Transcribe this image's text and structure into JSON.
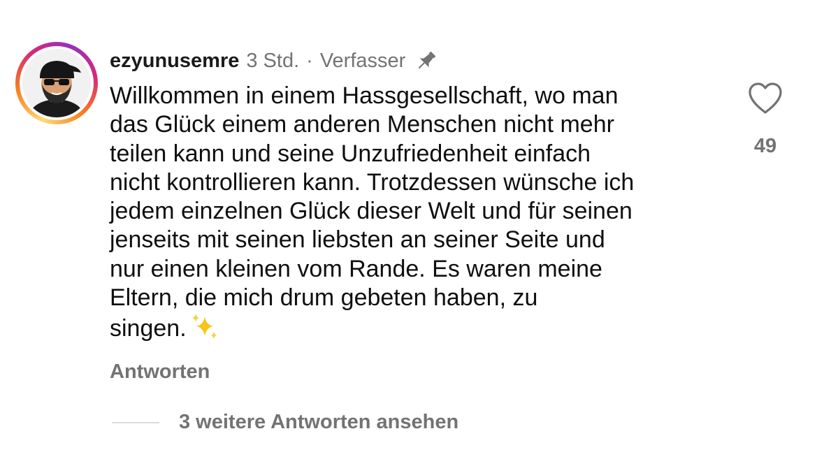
{
  "comment": {
    "username": "ezyunusemre",
    "time": "3 Std.",
    "separator": "·",
    "author_label": "Verfasser",
    "text": "Willkommen in einem Hassgesellschaft, wo man\ndas Glück einem anderen Menschen nicht mehr\nteilen kann und seine Unzufriedenheit einfach\nnicht kontrollieren kann. Trotzdessen wünsche ich\njedem einzelnen Glück dieser Welt und für seinen\njenseits mit seinen liebsten an seiner Seite und\nnur einen kleinen vom Rande. Es waren meine\nEltern, die mich drum gebeten haben, zu\nsingen.",
    "like_count": "49",
    "reply_label": "Antworten",
    "more_replies_label": "3 weitere Antworten ansehen"
  },
  "icons": {
    "pin": "pin-icon",
    "heart": "heart-icon",
    "sparkles": "sparkles-emoji",
    "avatar": "avatar-cartoon"
  },
  "colors": {
    "secondary_text": "#737373",
    "story_ring": [
      "#feda75",
      "#fa7e1e",
      "#d62976",
      "#962fbf"
    ]
  }
}
